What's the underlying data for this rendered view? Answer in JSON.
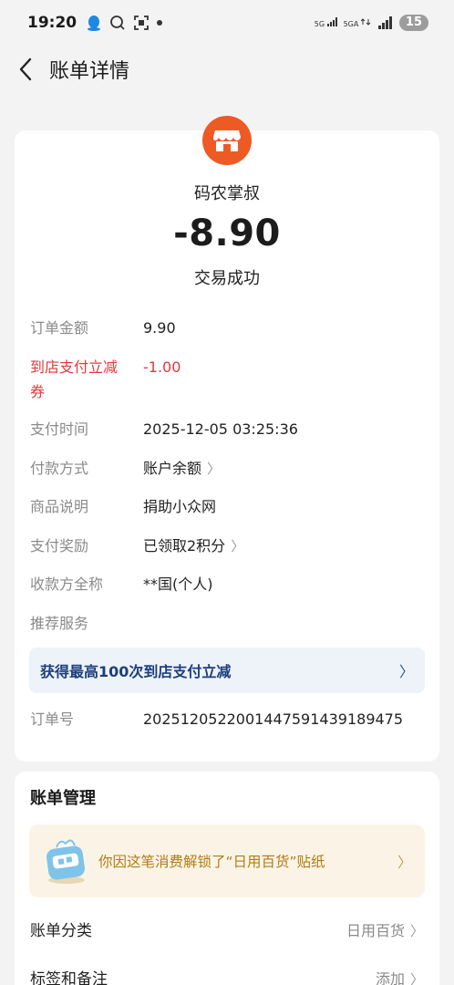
{
  "status_bar": {
    "time": "19:20",
    "net1": "5G",
    "net2": "5GA",
    "battery": "15"
  },
  "header": {
    "title": "账单详情"
  },
  "bill": {
    "merchant": "码农掌叔",
    "amount": "-8.90",
    "status": "交易成功"
  },
  "details": [
    {
      "key": "订单金额",
      "value": "9.90"
    },
    {
      "key": "到店支付立减",
      "key2": "券",
      "value": "-1.00"
    },
    {
      "key": "支付时间",
      "value": "2025-12-05 03:25:36"
    },
    {
      "key": "付款方式",
      "value": "账户余额"
    },
    {
      "key": "商品说明",
      "value": "捐助小众网"
    },
    {
      "key": "支付奖励",
      "value": "已领取2积分"
    },
    {
      "key": "收款方全称",
      "value": "**国(个人)"
    },
    {
      "key": "推荐服务",
      "value": ""
    }
  ],
  "promo": {
    "text": "获得最高100次到店支付立减"
  },
  "order": {
    "key": "订单号",
    "value": "2025120522001447591439189475"
  },
  "manage": {
    "title": "账单管理",
    "sticker_text": "你因这笔消费解锁了“日用百货”贴纸",
    "category_label": "账单分类",
    "category_value": "日用百货",
    "tags_label": "标签和备注",
    "tags_value": "添加"
  },
  "colors": {
    "accent_red": "#e2393c",
    "logo_orange": "#ee5a24",
    "promo_blue": "#1c3f7a",
    "sticker_gold": "#b07b16"
  }
}
